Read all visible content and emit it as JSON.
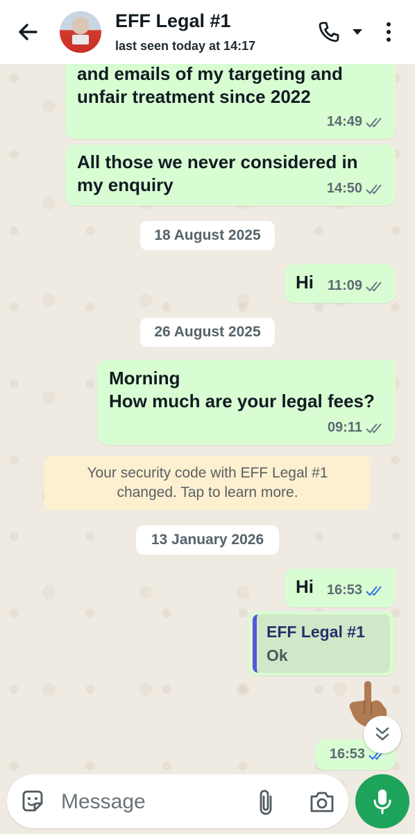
{
  "header": {
    "title": "EFF Legal #1",
    "status": "last seen today at 14:17",
    "icons": {
      "back": "arrow-left-icon",
      "call": "phone-icon",
      "dropdown": "chevron-down-icon",
      "menu": "more-vertical-icon"
    }
  },
  "messages": [
    {
      "text": "and emails of my targeting and\nunfair treatment since 2022",
      "time": "14:49",
      "read": false
    },
    {
      "text": "All those we never considered in\nmy enquiry",
      "time": "14:50",
      "read": false
    },
    {
      "text": "Hi",
      "time": "11:09",
      "read": false
    },
    {
      "text": "Morning\nHow much are your legal fees?",
      "time": "09:11",
      "read": false
    },
    {
      "text": "Hi",
      "time": "16:53",
      "read": true
    },
    {
      "text": "",
      "time": "16:53",
      "read": true
    }
  ],
  "dates": [
    "18 August 2025",
    "26 August 2025",
    "13 January 2026"
  ],
  "system_message": "Your security code with EFF Legal #1\nchanged. Tap to learn more.",
  "reply": {
    "name": "EFF Legal #1",
    "text": "Ok"
  },
  "composer": {
    "placeholder": "Message"
  },
  "colors": {
    "bubble": "#d9fdd3",
    "ticks_unread": "#667781",
    "ticks_read": "#2f6fe6",
    "mic_button": "#1ea35a",
    "system_bg": "#fdf0d1",
    "quote_bar": "#5a55d8"
  }
}
